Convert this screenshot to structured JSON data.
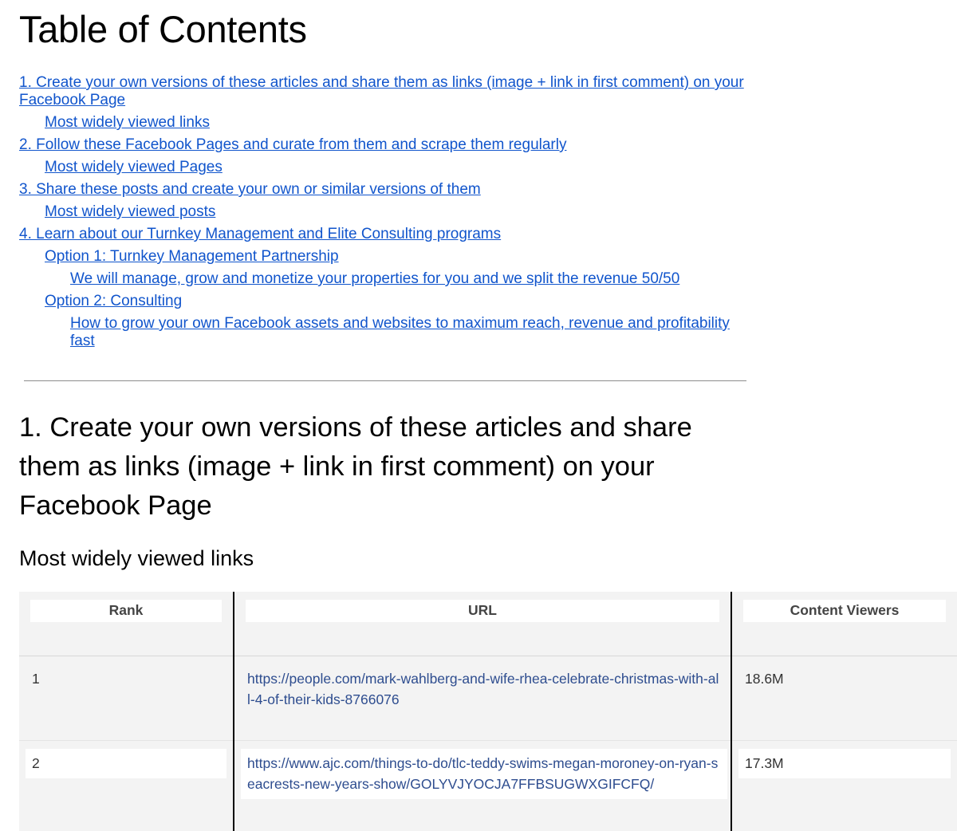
{
  "toc": {
    "title": "Table of Contents",
    "items": [
      {
        "level": 1,
        "text": "1. Create your own versions of these articles and share them as links (image + link in first comment) on your Facebook Page"
      },
      {
        "level": 2,
        "text": "Most widely viewed links"
      },
      {
        "level": 1,
        "text": "2. Follow these Facebook Pages and curate from them and scrape them regularly"
      },
      {
        "level": 2,
        "text": "Most widely viewed Pages"
      },
      {
        "level": 1,
        "text": "3. Share these posts and create your own or similar versions of them"
      },
      {
        "level": 2,
        "text": "Most widely viewed posts"
      },
      {
        "level": 1,
        "text": "4. Learn about our Turnkey Management and Elite Consulting programs"
      },
      {
        "level": 2,
        "text": "Option 1: Turnkey Management Partnership"
      },
      {
        "level": 3,
        "text": "We will manage, grow and monetize your properties for you and we split the revenue 50/50"
      },
      {
        "level": 2,
        "text": "Option 2: Consulting"
      },
      {
        "level": 3,
        "text": "How to grow your own Facebook assets and websites to maximum reach, revenue and profitability fast"
      }
    ]
  },
  "section1": {
    "heading": "1. Create your own versions of these articles and share them as links (image + link in first comment) on your Facebook Page",
    "subheading": "Most widely viewed links"
  },
  "table": {
    "headers": {
      "rank": "Rank",
      "url": "URL",
      "viewers": "Content Viewers"
    },
    "rows": [
      {
        "rank": "1",
        "url": "https://people.com/mark-wahlberg-and-wife-rhea-celebrate-christmas-with-all-4-of-their-kids-8766076",
        "viewers": "18.6M"
      },
      {
        "rank": "2",
        "url": "https://www.ajc.com/things-to-do/tlc-teddy-swims-megan-moroney-on-ryan-seacrests-new-years-show/GOLYVJYOCJA7FFBSUGWXGIFCFQ/",
        "viewers": "17.3M"
      }
    ]
  },
  "colors": {
    "link": "#1155cc",
    "table_bg": "#f3f3f3",
    "divider": "#8c8c8c"
  }
}
